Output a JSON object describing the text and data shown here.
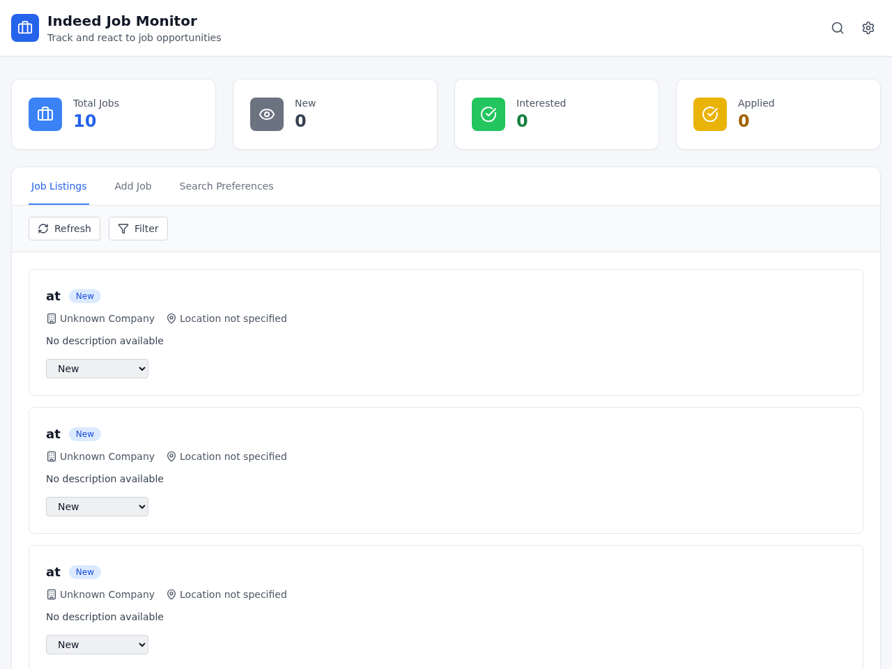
{
  "header": {
    "title": "Indeed Job Monitor",
    "subtitle": "Track and react to job opportunities"
  },
  "stats": [
    {
      "kind": "total",
      "label": "Total Jobs",
      "value": "10",
      "color": "#3b82f6"
    },
    {
      "kind": "new",
      "label": "New",
      "value": "0",
      "color": "#6b7280"
    },
    {
      "kind": "interested",
      "label": "Interested",
      "value": "0",
      "color": "#22c55e"
    },
    {
      "kind": "applied",
      "label": "Applied",
      "value": "0",
      "color": "#eab308"
    }
  ],
  "tabs": [
    {
      "label": "Job Listings",
      "selected": true
    },
    {
      "label": "Add Job",
      "selected": false
    },
    {
      "label": "Search Preferences",
      "selected": false
    }
  ],
  "toolbar": {
    "refresh_button": "Refresh",
    "filter_button": "Filter"
  },
  "jobs": [
    {
      "title": "at",
      "badge": "New",
      "company": "Unknown Company",
      "location": "Location not specified",
      "description": "No description available",
      "status": "New"
    },
    {
      "title": "at",
      "badge": "New",
      "company": "Unknown Company",
      "location": "Location not specified",
      "description": "No description available",
      "status": "New"
    },
    {
      "title": "at",
      "badge": "New",
      "company": "Unknown Company",
      "location": "Location not specified",
      "description": "No description available",
      "status": "New"
    }
  ]
}
